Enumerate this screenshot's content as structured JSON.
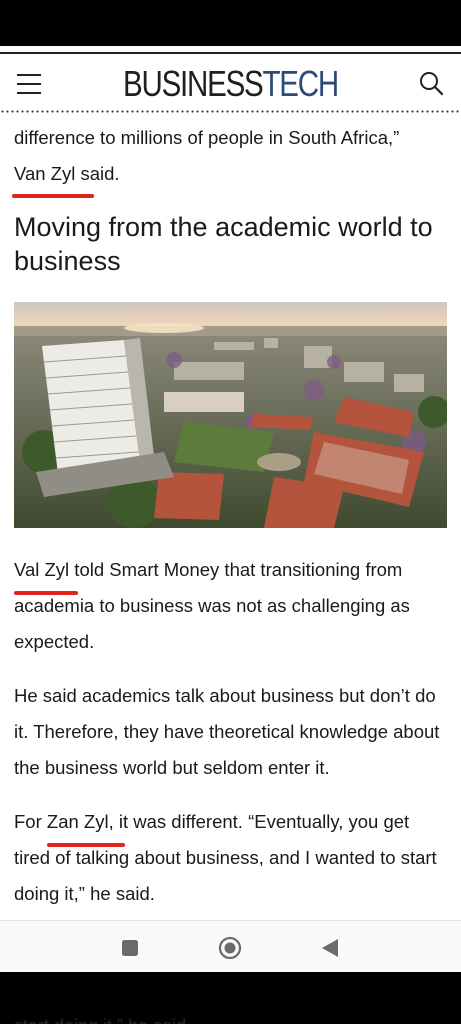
{
  "header": {
    "logo_business": "BUSINESS",
    "logo_tech": "TECH"
  },
  "article": {
    "para1_line1": "difference to millions of people in South Africa,”",
    "para1_name": "Van Zyl",
    "para1_rest": " said.",
    "heading": "Moving from the academic world to business",
    "para2_name": "Val Zyl",
    "para2_rest": " told Smart Money that transitioning from academia to business was not as challenging as expected.",
    "para3": "He said academics talk about business but don’t do it. Therefore, they have theoretical knowledge about the business world but seldom enter it.",
    "para4_pre": "For ",
    "para4_name": "Zan Zyl",
    "para4_rest": ", it was different. “Eventually, you get tired of talking about business, and I wanted to start doing it,” he said."
  },
  "bottom_ghost": "start doing it,” he said.",
  "icons": {
    "menu": "hamburger-menu-icon",
    "search": "search-icon",
    "recents": "square-icon",
    "home": "circle-home-icon",
    "back": "triangle-back-icon"
  },
  "colors": {
    "underline": "#e0231b",
    "brand_tech": "#2b4a78"
  }
}
